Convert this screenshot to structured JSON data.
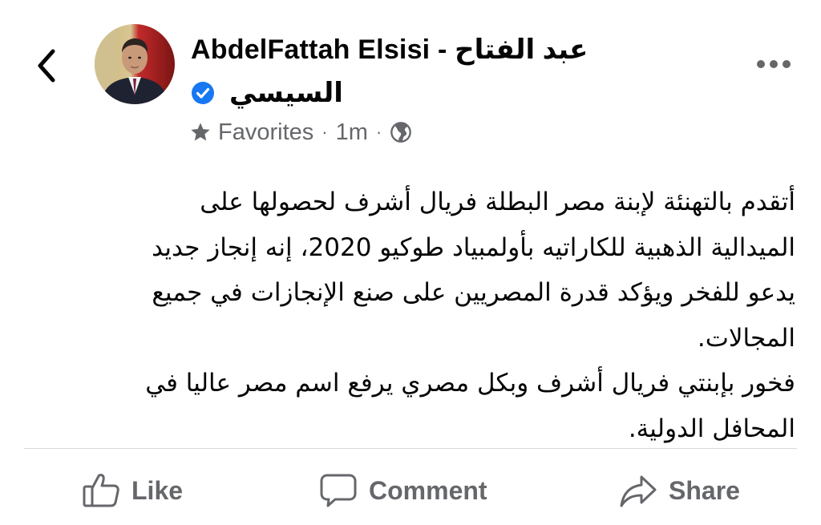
{
  "header": {
    "author_name_latin": "AbdelFattah Elsisi - عبد  الفتاح",
    "author_name_arabic": "السيسي",
    "list_label": "Favorites",
    "meta_separator": "·",
    "time_ago": "1m",
    "icons": {
      "back": "chevron-left-icon",
      "verified": "verified-badge-icon",
      "favorites": "star-icon",
      "audience": "globe-icon",
      "more": "more-dots-icon"
    },
    "colors": {
      "verified_blue": "#1877f2",
      "meta_gray": "#65676b"
    }
  },
  "post": {
    "paragraph_1": "أتقدم بالتهنئة لإبنة مصر البطلة فريال أشرف لحصولها على الميدالية الذهبية للكاراتيه بأولمبياد طوكيو 2020، إنه إنجاز جديد يدعو للفخر ويؤكد قدرة المصريين على صنع الإنجازات في جميع المجالات.",
    "paragraph_1_lines": [
      "أتقدم بالتهنئة لإبنة مصر البطلة فريال أشرف لحصولها على",
      "الميدالية الذهبية للكاراتيه بأولمبياد طوكيو 2020، إنه إنجاز جديد",
      "يدعو للفخر ويؤكد قدرة المصريين على صنع الإنجازات في جميع",
      "المجالات."
    ],
    "paragraph_2_lines": [
      "فخور بإبنتي فريال أشرف وبكل مصري يرفع اسم مصر عاليا في",
      "المحافل الدولية."
    ]
  },
  "actions": {
    "like_label": "Like",
    "comment_label": "Comment",
    "share_label": "Share",
    "icons": {
      "like": "thumbs-up-icon",
      "comment": "comment-bubble-icon",
      "share": "share-arrow-icon"
    }
  }
}
